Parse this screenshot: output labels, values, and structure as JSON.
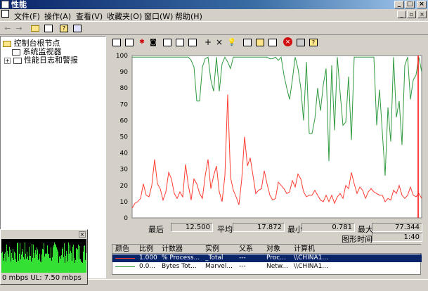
{
  "window": {
    "title": "性能"
  },
  "menu": [
    "文件(F)",
    "操作(A)",
    "查看(V)",
    "收藏夹(O)",
    "窗口(W)",
    "帮助(H)"
  ],
  "tree": {
    "root": "控制台根节点",
    "items": [
      "系统监视器",
      "性能日志和警报"
    ]
  },
  "chart_data": {
    "type": "line",
    "ylim": [
      0,
      100
    ],
    "yticks": [
      "100",
      "90",
      "80",
      "70",
      "60",
      "50",
      "40",
      "30",
      "20",
      "10",
      "0"
    ],
    "series": [
      {
        "color": "#ff3b30",
        "values": [
          6,
          9,
          10,
          12,
          21,
          14,
          13,
          20,
          36,
          21,
          18,
          11,
          16,
          28,
          24,
          15,
          12,
          16,
          13,
          33,
          20,
          11,
          24,
          21,
          15,
          12,
          26,
          36,
          18,
          26,
          32,
          16,
          10,
          26,
          76,
          25,
          17,
          13,
          8,
          24,
          50,
          32,
          37,
          26,
          15,
          17,
          18,
          29,
          21,
          14,
          11,
          12,
          22,
          20,
          18,
          15,
          16,
          23,
          19,
          27,
          24,
          16,
          13,
          14,
          14,
          17,
          14,
          11,
          10,
          14,
          10,
          14,
          9,
          13,
          15,
          12,
          20,
          18,
          28,
          21,
          15,
          19,
          17,
          12,
          16,
          18,
          16,
          15,
          14,
          14,
          10,
          12,
          11,
          17,
          15,
          20,
          14,
          12,
          14,
          19,
          14,
          13,
          15,
          12
        ]
      },
      {
        "color": "#2e9a3e",
        "values": [
          99,
          99,
          99,
          99,
          99,
          99,
          99,
          99,
          99,
          99,
          99,
          99,
          99,
          99,
          99,
          99,
          99,
          99,
          99,
          99,
          99,
          97,
          93,
          72,
          72,
          93,
          98,
          99,
          85,
          78,
          99,
          78,
          95,
          99,
          96,
          92,
          99,
          99,
          99,
          99,
          99,
          99,
          99,
          99,
          99,
          99,
          99,
          99,
          99,
          98,
          98,
          99,
          97,
          99,
          88,
          80,
          73,
          85,
          99,
          92,
          80,
          60,
          96,
          52,
          52,
          61,
          80,
          66,
          82,
          92,
          35,
          94,
          54,
          99,
          77,
          57,
          59,
          87,
          48,
          99,
          99,
          99,
          99,
          99,
          99,
          99,
          99,
          57,
          79,
          53,
          26,
          68,
          47,
          99,
          62,
          72,
          45,
          94,
          99,
          73,
          85,
          88,
          99,
          90
        ]
      }
    ]
  },
  "stats": {
    "last_label": "最后",
    "last_value": "12.500",
    "avg_label": "平均",
    "avg_value": "17.872",
    "min_label": "最小",
    "min_value": "0.781",
    "max_label": "最大",
    "max_value": "77.344",
    "duration_label": "图形时间",
    "duration_value": "1:40"
  },
  "legend_headers": [
    "颜色",
    "比例",
    "计数器",
    "实例",
    "父系",
    "对象",
    "计算机"
  ],
  "legend_rows": [
    {
      "scale": "1.000",
      "counter": "% Process...",
      "instance": "_Total",
      "parent": "---",
      "object": "Proc...",
      "computer": "\\\\CHINA1..."
    },
    {
      "scale": "0.0...",
      "counter": "Bytes Tot...",
      "instance": "Marvel...",
      "parent": "---",
      "object": "Netw...",
      "computer": "\\\\CHINA1..."
    }
  ],
  "net_widget": {
    "text": "0 mbps  UL: 7.50 mbps"
  }
}
